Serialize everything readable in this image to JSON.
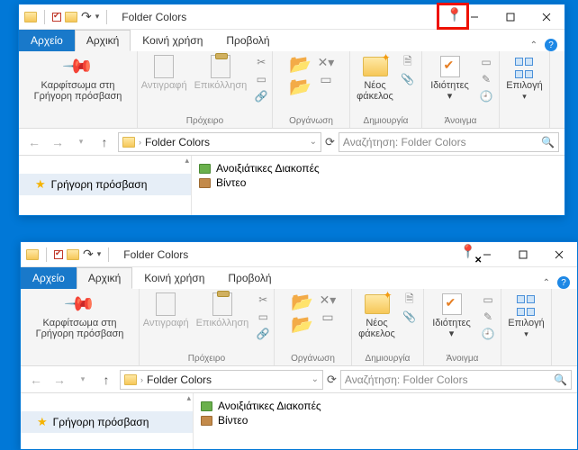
{
  "title": "Folder Colors",
  "tabs": {
    "file": "Αρχείο",
    "home": "Αρχική",
    "share": "Κοινή χρήση",
    "view": "Προβολή"
  },
  "ribbon": {
    "pin": "Καρφίτσωμα στη\nΓρήγορη πρόσβαση",
    "copy": "Αντιγραφή",
    "paste": "Επικόλληση",
    "clipboard_group": "Πρόχειρο",
    "organize_group": "Οργάνωση",
    "newfolder": "Νέος\nφάκελος",
    "new_group": "Δημιουργία",
    "properties": "Ιδιότητες",
    "open_group": "Άνοιγμα",
    "select": "Επιλογή",
    "move_to": "▾",
    "copy_to": "▾"
  },
  "breadcrumb": "Folder Colors",
  "search_placeholder": "Αναζήτηση: Folder Colors",
  "sidebar_quick": "Γρήγορη πρόσβαση",
  "files": [
    {
      "name": "Ανοιξιάτικες Διακοπές",
      "color": "green"
    },
    {
      "name": "Βίντεο",
      "color": "brown"
    }
  ]
}
